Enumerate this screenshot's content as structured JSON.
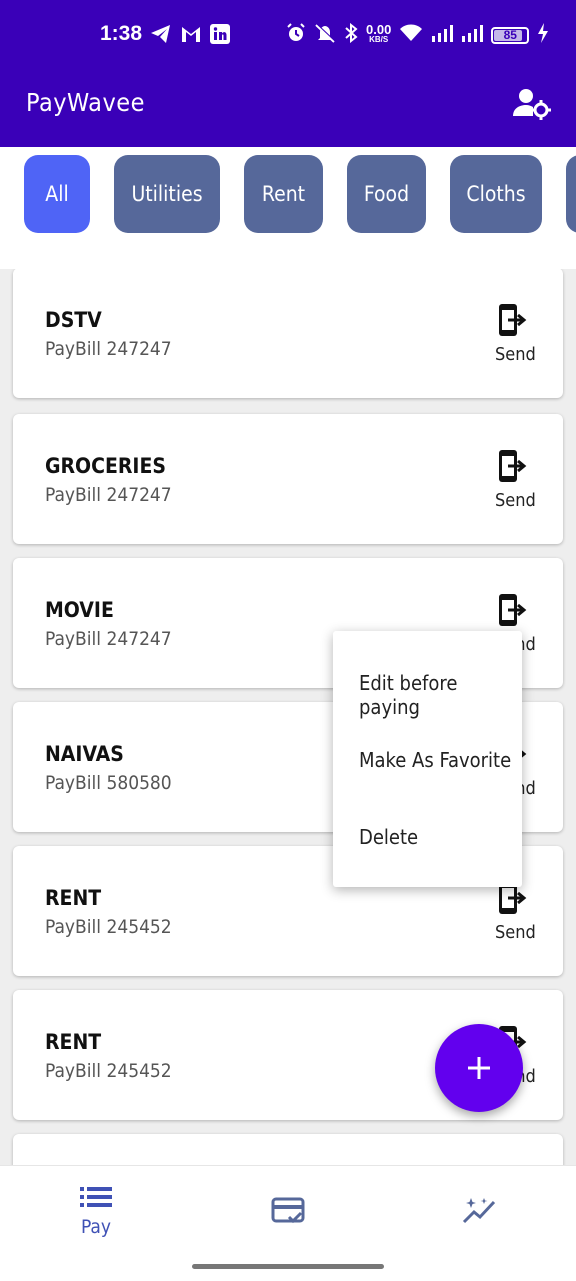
{
  "status_bar": {
    "time": "1:38",
    "network_speed_value": "0.00",
    "network_speed_unit": "KB/S",
    "battery": "85"
  },
  "app_bar": {
    "title": "PayWavee"
  },
  "categories": [
    {
      "label": "All",
      "active": true
    },
    {
      "label": "Utilities",
      "active": false
    },
    {
      "label": "Rent",
      "active": false
    },
    {
      "label": "Food",
      "active": false
    },
    {
      "label": "Cloths",
      "active": false
    }
  ],
  "bills": [
    {
      "name": "DSTV",
      "detail": "PayBill 247247",
      "action": "Send"
    },
    {
      "name": "GROCERIES",
      "detail": "PayBill 247247",
      "action": "Send"
    },
    {
      "name": "MOVIE",
      "detail": "PayBill 247247",
      "action": "Send"
    },
    {
      "name": "NAIVAS",
      "detail": "PayBill 580580",
      "action": "Send"
    },
    {
      "name": "RENT",
      "detail": "PayBill 245452",
      "action": "Send"
    },
    {
      "name": "RENT",
      "detail": "PayBill 245452",
      "action": "Send"
    }
  ],
  "context_menu": {
    "items": [
      "Edit before paying",
      "Make As Favorite",
      "Delete"
    ]
  },
  "bottom_nav": {
    "pay_label": "Pay"
  },
  "colors": {
    "primary": "#3a00b8",
    "chip": "#56689a",
    "chip_active": "#4f64f6",
    "fab": "#6200ee",
    "nav_accent": "#3f51b5"
  }
}
